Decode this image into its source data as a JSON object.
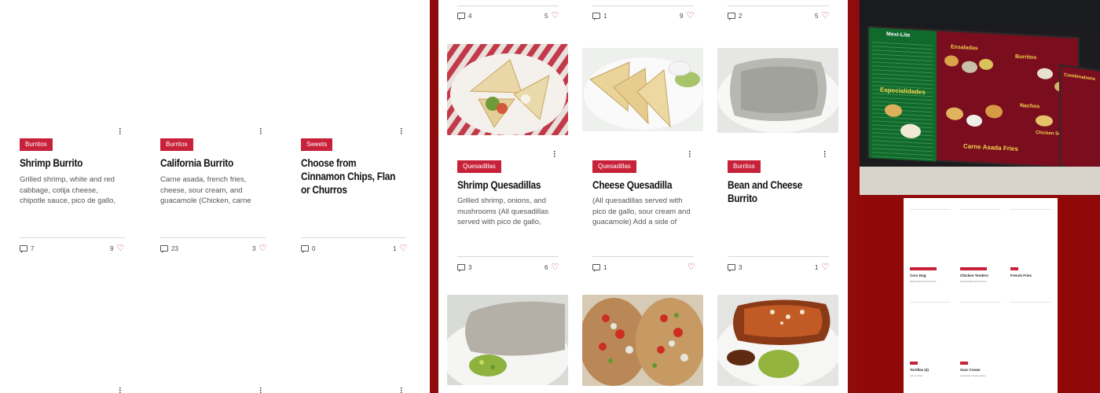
{
  "panel1": {
    "cards": [
      {
        "badge": "Burritos",
        "title": "Shrimp Burrito",
        "description": "Grilled shrimp, white and red cabbage, cotija cheese, chipotle sauce, pico de gallo, side of so…",
        "comments": "7",
        "likes": "9"
      },
      {
        "badge": "Burritos",
        "title": "California Burrito",
        "description": "Carne asada, french fries, cheese, sour cream, and guacamole (Chicken, carne asada, al pastor…",
        "comments": "23",
        "likes": "3"
      },
      {
        "badge": "Sweets",
        "title": "Choose from Cinnamon Chips, Flan or Churros",
        "description": "",
        "comments": "0",
        "likes": "1"
      }
    ]
  },
  "panel2": {
    "top_stats": [
      {
        "comments": "4",
        "likes": "5"
      },
      {
        "comments": "1",
        "likes": "9"
      },
      {
        "comments": "2",
        "likes": "5"
      }
    ],
    "cards": [
      {
        "badge": "Quesadillas",
        "title": "Shrimp Quesadillas",
        "description": "Grilled shrimp, onions, and mushrooms (All quesadillas served with pico de gallo, sour…",
        "comments": "3",
        "likes": "6"
      },
      {
        "badge": "Quesadillas",
        "title": "Cheese Quesadilla",
        "description": "(All quesadillas served with pico de gallo, sour cream and guacamole) Add a side of rice…",
        "comments": "1",
        "likes": ""
      },
      {
        "badge": "Burritos",
        "title": "Bean and Cheese Burrito",
        "description": "",
        "comments": "3",
        "likes": "1"
      }
    ]
  },
  "menu_board": {
    "title_left": "Mexi-Lite",
    "heading_ensaladas": "Ensaladas",
    "heading_burritos": "Burritos",
    "heading_especialidades": "Especialidades",
    "heading_nachos": "Nachos",
    "heading_carne_asada_fries": "Carne Asada Fries",
    "heading_chicken_soup": "Chicken Soup",
    "heading_combinations": "Combinations"
  },
  "mini_grid": {
    "cards_row1": [
      {
        "title": "Corn Dog",
        "description": "Served with French Fries"
      },
      {
        "title": "Chicken Tenders",
        "description": "Served with French Fries"
      },
      {
        "title": "French Fries",
        "description": ""
      }
    ],
    "cards_row2": [
      {
        "title": "Tortillas (4)",
        "description": "corn or flour"
      },
      {
        "title": "Sour Cream",
        "description": "small side of sour cream"
      }
    ]
  },
  "colors": {
    "accent": "#c8213a",
    "maroon": "#8f0a0a",
    "board": "#7a0d1e"
  }
}
